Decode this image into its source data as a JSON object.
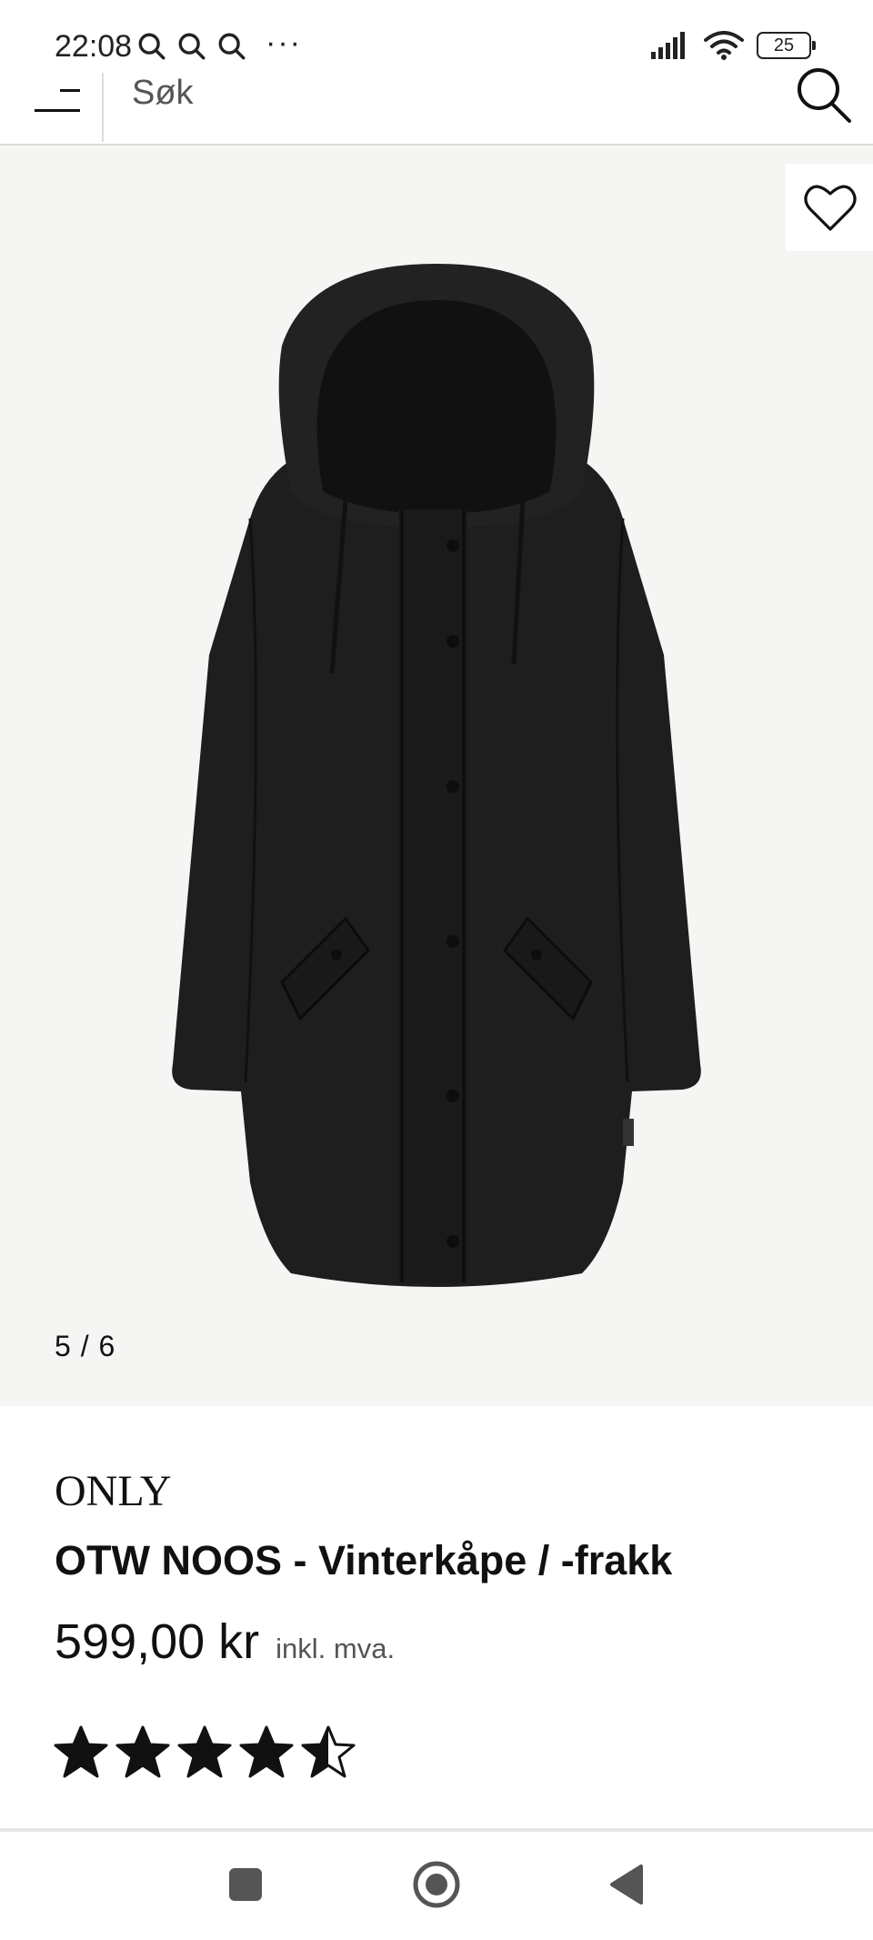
{
  "status_bar": {
    "time": "22:08",
    "left_icons": [
      "search-icon",
      "search-icon",
      "search-icon"
    ],
    "overflow": "···",
    "battery": "25"
  },
  "header": {
    "search_placeholder": "Søk"
  },
  "gallery": {
    "counter": "5 / 6",
    "image_alt": "black-hooded-coat"
  },
  "product": {
    "brand": "ONLY",
    "title": "OTW NOOS - Vinterkåpe / -frakk",
    "price": "599,00 kr",
    "vat_note": "inkl. mva.",
    "rating": 4.5,
    "rating_max": 5
  },
  "colors": {
    "gallery_bg": "#f5f5f3",
    "text": "#111111",
    "muted": "#555555"
  }
}
